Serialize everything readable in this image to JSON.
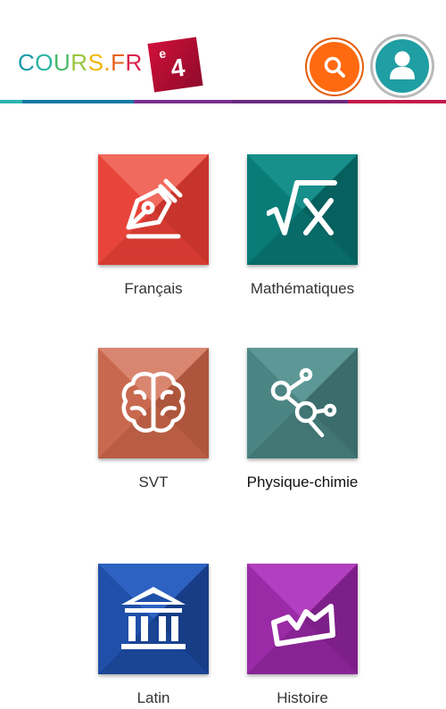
{
  "header": {
    "logo_letters": [
      "C",
      "O",
      "U",
      "R",
      "S",
      ".",
      "F",
      "R"
    ],
    "logo_letter_colors": [
      "#1b9aaa",
      "#2bb5a4",
      "#4bb96a",
      "#9bc53d",
      "#f2b705",
      "#f29a05",
      "#e5631c",
      "#d9234b"
    ],
    "grade": "4",
    "grade_suffix": "e",
    "search_icon": "search-icon",
    "profile_icon": "user-icon"
  },
  "subjects": [
    {
      "label": "Français",
      "icon": "pen-nib-icon",
      "color": "#e8443a",
      "light": "#f06a5e",
      "dark": "#c7342b"
    },
    {
      "label": "Mathématiques",
      "icon": "square-root-x-icon",
      "color": "#0a7c78",
      "light": "#178f8a",
      "dark": "#06605d"
    },
    {
      "label": "SVT",
      "icon": "brain-icon",
      "color": "#c8694f",
      "light": "#d98670",
      "dark": "#ad553d"
    },
    {
      "label": "Physique-chimie",
      "icon": "molecule-icon",
      "color": "#4b8583",
      "light": "#5d9896",
      "dark": "#3a6d6b"
    },
    {
      "label": "Latin",
      "icon": "temple-icon",
      "color": "#1f4fa8",
      "light": "#2d62c2",
      "dark": "#173d87"
    },
    {
      "label": "Histoire",
      "icon": "crown-icon",
      "color": "#9a2aa6",
      "light": "#b23fbf",
      "dark": "#7d1f88"
    }
  ]
}
